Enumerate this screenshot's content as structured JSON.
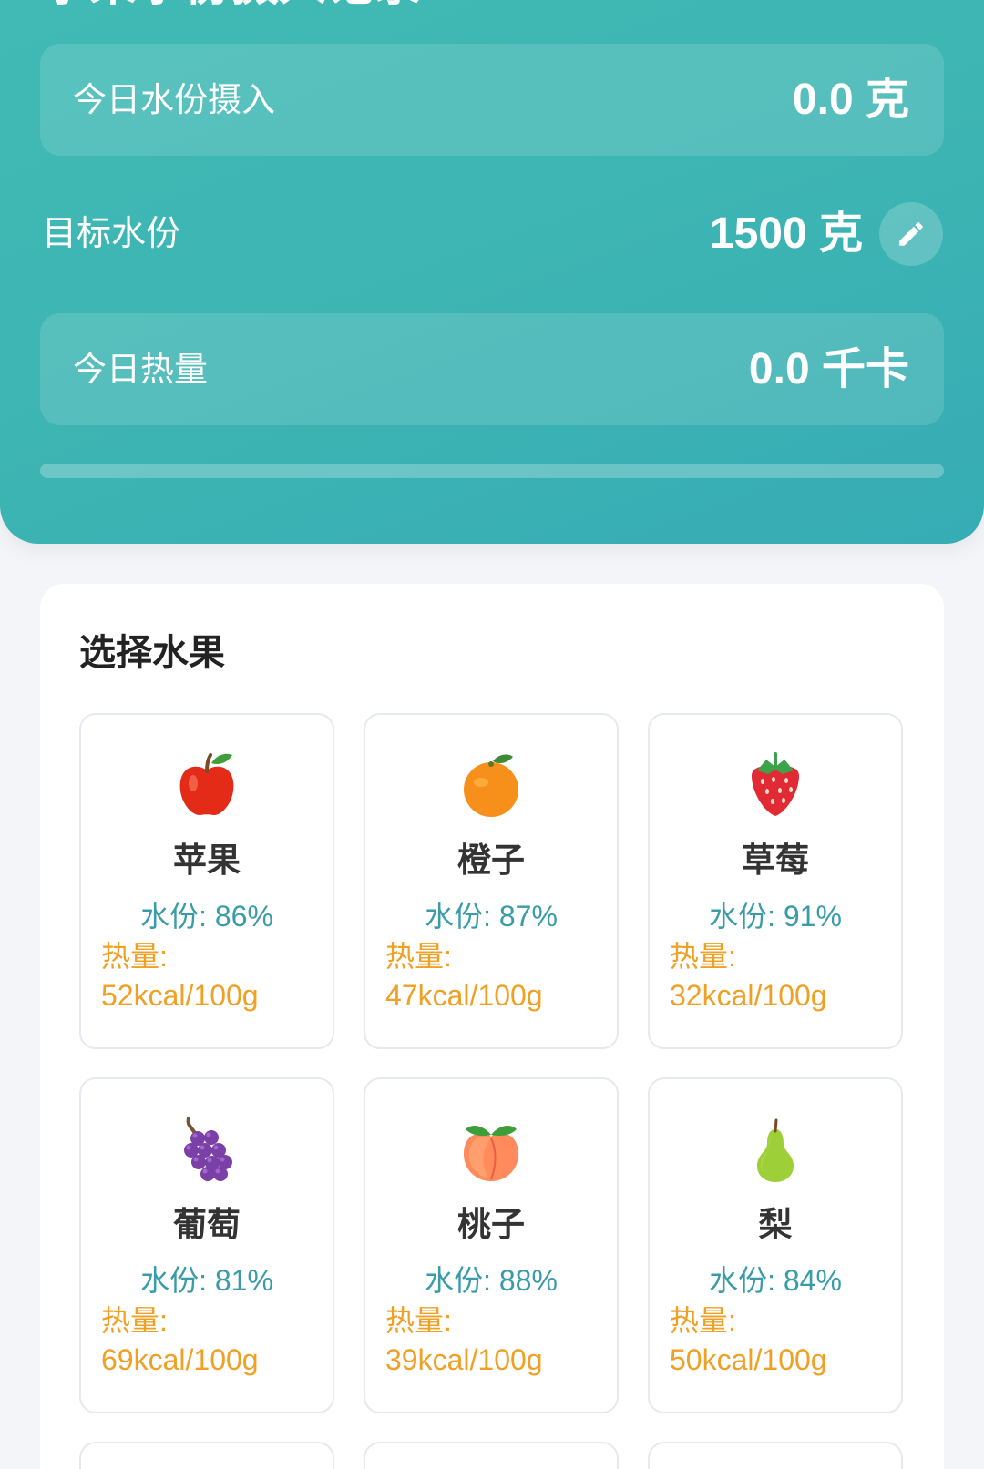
{
  "header": {
    "title": "水果水份摄入记录",
    "intake": {
      "label": "今日水份摄入",
      "value": "0.0 克"
    },
    "goal": {
      "label": "目标水份",
      "value": "1500 克",
      "edit_icon": "pencil-icon"
    },
    "calories": {
      "label": "今日热量",
      "value": "0.0 千卡"
    },
    "progress": {
      "fraction": 0
    }
  },
  "fruit_section": {
    "title": "选择水果",
    "fruits": [
      {
        "name": "苹果",
        "icon": "apple-icon",
        "water": "水份: 86%",
        "calorie_label": "热量:",
        "calorie_value": "52kcal/100g"
      },
      {
        "name": "橙子",
        "icon": "orange-icon",
        "water": "水份: 87%",
        "calorie_label": "热量:",
        "calorie_value": "47kcal/100g"
      },
      {
        "name": "草莓",
        "icon": "strawberry-icon",
        "water": "水份: 91%",
        "calorie_label": "热量:",
        "calorie_value": "32kcal/100g"
      },
      {
        "name": "葡萄",
        "icon": "grapes-icon",
        "water": "水份: 81%",
        "calorie_label": "热量:",
        "calorie_value": "69kcal/100g"
      },
      {
        "name": "桃子",
        "icon": "peach-icon",
        "water": "水份: 88%",
        "calorie_label": "热量:",
        "calorie_value": "39kcal/100g"
      },
      {
        "name": "梨",
        "icon": "pear-icon",
        "water": "水份: 84%",
        "calorie_label": "热量:",
        "calorie_value": "50kcal/100g"
      }
    ]
  },
  "colors": {
    "header": "#3db5b3",
    "water_text": "#3a9ca8",
    "calorie_text": "#f0a024",
    "fruit_name": "#333333",
    "page_background": "#f3f5f8"
  }
}
